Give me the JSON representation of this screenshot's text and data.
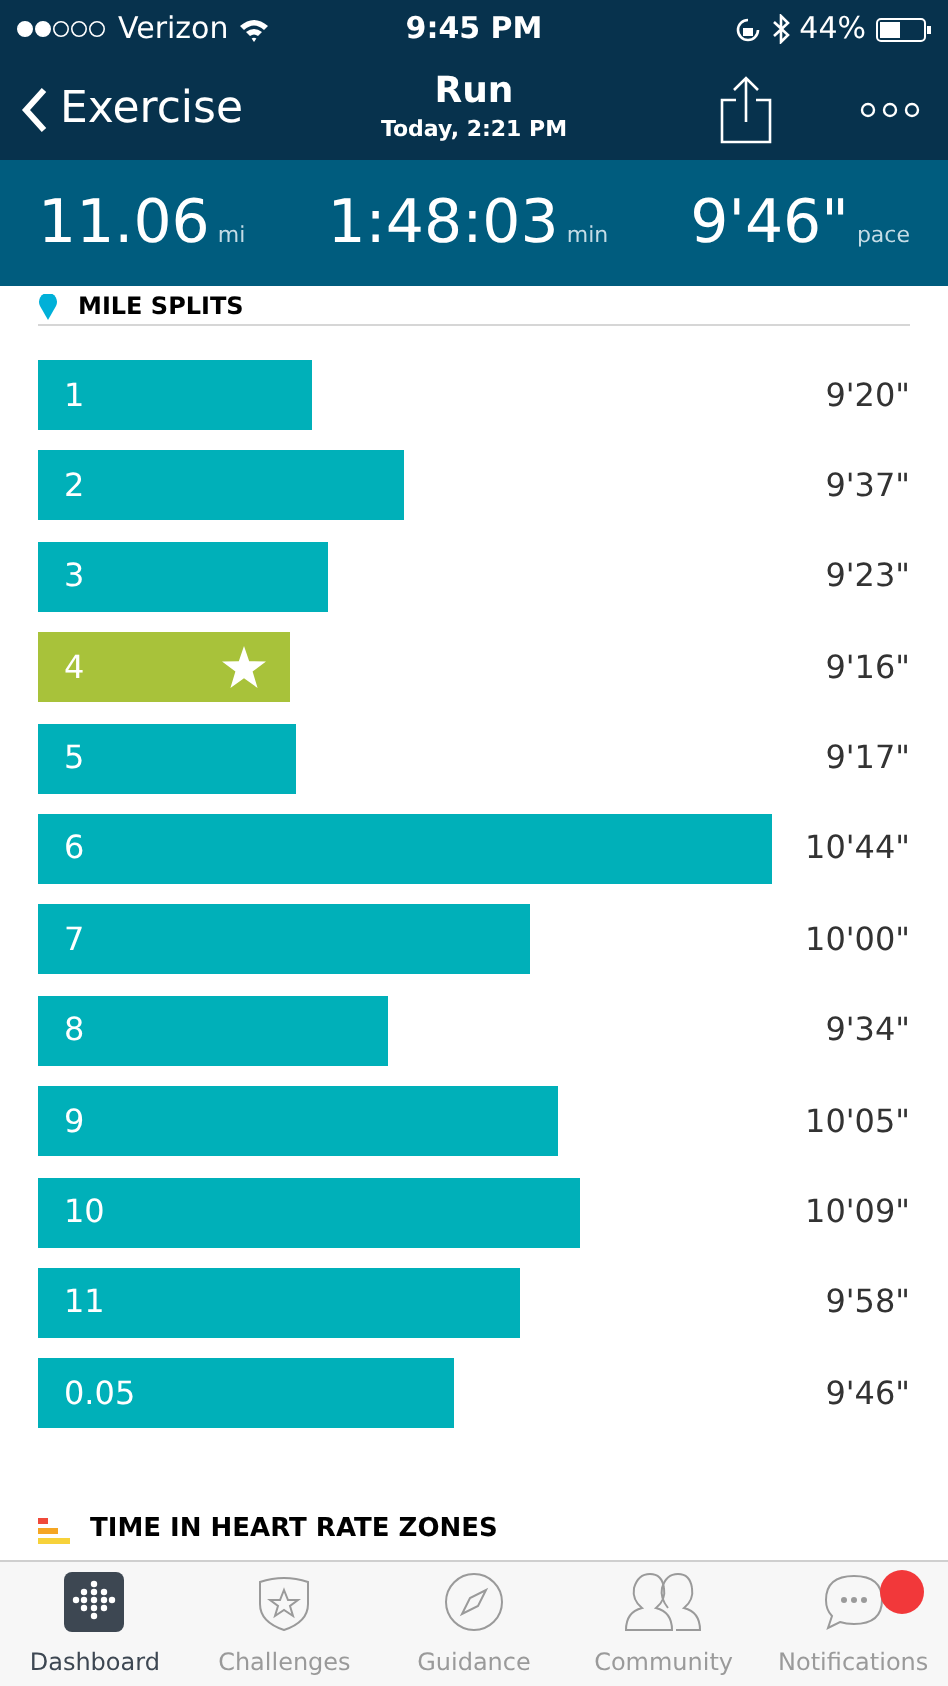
{
  "status_bar": {
    "carrier": "Verizon",
    "time": "9:45 PM",
    "battery": "44%"
  },
  "nav": {
    "back": "Exercise",
    "title": "Run",
    "subtitle": "Today, 2:21 PM"
  },
  "stats": [
    {
      "value": "11.06",
      "unit": "mi"
    },
    {
      "value": "1:48:03",
      "unit": "min"
    },
    {
      "value": "9'46\"",
      "unit": "pace"
    }
  ],
  "splits_title": "MILE SPLITS",
  "splits": [
    {
      "label": "1",
      "pace": "9'20\"",
      "best": false
    },
    {
      "label": "2",
      "pace": "9'37\"",
      "best": false
    },
    {
      "label": "3",
      "pace": "9'23\"",
      "best": false
    },
    {
      "label": "4",
      "pace": "9'16\"",
      "best": true
    },
    {
      "label": "5",
      "pace": "9'17\"",
      "best": false
    },
    {
      "label": "6",
      "pace": "10'44\"",
      "best": false
    },
    {
      "label": "7",
      "pace": "10'00\"",
      "best": false
    },
    {
      "label": "8",
      "pace": "9'34\"",
      "best": false
    },
    {
      "label": "9",
      "pace": "10'05\"",
      "best": false
    },
    {
      "label": "10",
      "pace": "10'09\"",
      "best": false
    },
    {
      "label": "11",
      "pace": "9'58\"",
      "best": false
    },
    {
      "label": "0.05",
      "pace": "9'46\"",
      "best": false
    }
  ],
  "zones_title": "TIME IN HEART RATE ZONES",
  "tabs": [
    {
      "label": "Dashboard",
      "kind": "dashboard",
      "selected": true
    },
    {
      "label": "Challenges",
      "kind": "challenges",
      "selected": false
    },
    {
      "label": "Guidance",
      "kind": "guidance",
      "selected": false
    },
    {
      "label": "Community",
      "kind": "community",
      "selected": false
    },
    {
      "label": "Notifications",
      "kind": "notifications",
      "selected": false,
      "badge": true
    }
  ]
}
